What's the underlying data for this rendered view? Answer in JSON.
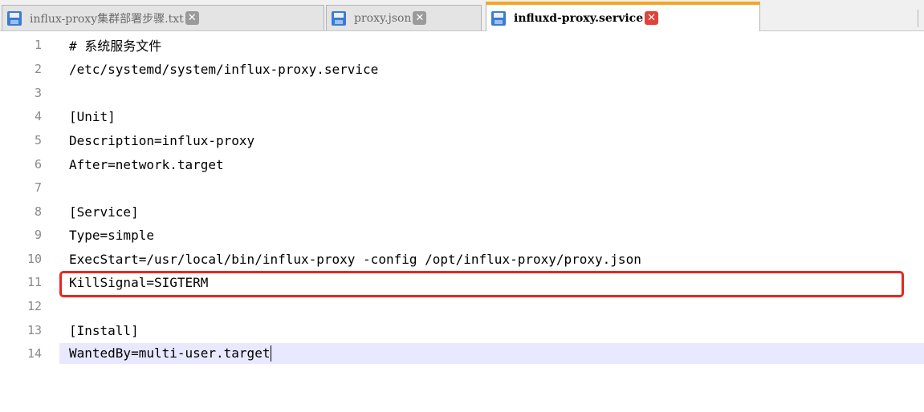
{
  "tabs": [
    {
      "label": "influx-proxy集群部署步骤.txt",
      "active": false,
      "close_icon": "close-icon"
    },
    {
      "label": "proxy.json",
      "active": false,
      "close_icon": "close-icon"
    },
    {
      "label": "influxd-proxy.service",
      "active": true,
      "close_icon": "close-icon"
    }
  ],
  "editor": {
    "lines": [
      {
        "num": "1",
        "text": "# 系统服务文件"
      },
      {
        "num": "2",
        "text": "/etc/systemd/system/influx-proxy.service"
      },
      {
        "num": "3",
        "text": ""
      },
      {
        "num": "4",
        "text": "[Unit]"
      },
      {
        "num": "5",
        "text": "Description=influx-proxy"
      },
      {
        "num": "6",
        "text": "After=network.target"
      },
      {
        "num": "7",
        "text": ""
      },
      {
        "num": "8",
        "text": "[Service]"
      },
      {
        "num": "9",
        "text": "Type=simple"
      },
      {
        "num": "10",
        "text": "ExecStart=/usr/local/bin/influx-proxy -config /opt/influx-proxy/proxy.json"
      },
      {
        "num": "11",
        "text": "KillSignal=SIGTERM"
      },
      {
        "num": "12",
        "text": ""
      },
      {
        "num": "13",
        "text": "[Install]"
      },
      {
        "num": "14",
        "text": "WantedBy=multi-user.target"
      }
    ],
    "current_line": "14",
    "highlighted_line": "10"
  },
  "colors": {
    "active_tab_accent": "#f5a623",
    "highlight_box": "#e8261f",
    "current_line_bg": "#e8e8ff"
  }
}
